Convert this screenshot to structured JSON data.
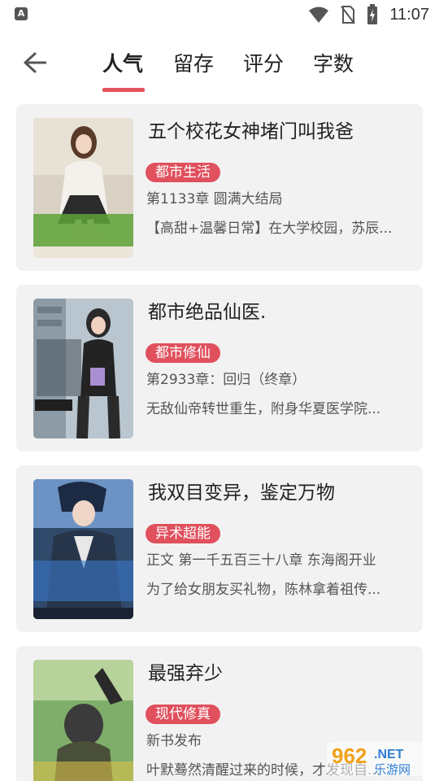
{
  "status_bar": {
    "left_icon": "a-letter-icon",
    "left_letter": "A",
    "time": "11:07"
  },
  "header": {
    "tabs": [
      {
        "label": "人气",
        "active": true
      },
      {
        "label": "留存",
        "active": false
      },
      {
        "label": "评分",
        "active": false
      },
      {
        "label": "字数",
        "active": false
      }
    ],
    "accent_color": "#e4525c"
  },
  "books": [
    {
      "title": "五个校花女神堵门叫我爸",
      "tag": "都市生活",
      "chapter": "第1133章 圆满大结局",
      "description": "【高甜+温馨日常】在大学校园，苏辰..."
    },
    {
      "title": "都市绝品仙医.",
      "tag": "都市修仙",
      "chapter": "第2933章：回归（终章）",
      "description": "无敌仙帝转世重生，附身华夏医学院..."
    },
    {
      "title": "我双目变异，鉴定万物",
      "tag": "异术超能",
      "chapter": "正文 第一千五百三十八章 东海阁开业",
      "description": "为了给女朋友买礼物，陈林拿着祖传..."
    },
    {
      "title": "最强弃少",
      "tag": "现代修真",
      "chapter": "新书发布",
      "description": "叶默蓦然清醒过来的时候，才发现自..."
    }
  ],
  "watermark": {
    "number": "962",
    "suffix": ".NET",
    "site": "乐游网"
  },
  "colors": {
    "tag_bg": "#e0505d",
    "card_bg": "#f2f2f2"
  }
}
